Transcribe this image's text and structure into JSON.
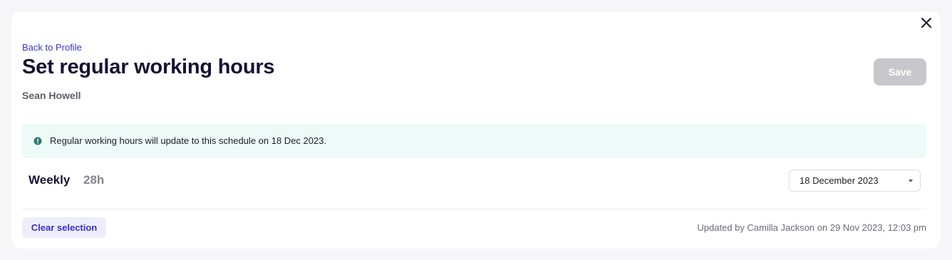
{
  "header": {
    "back_link": "Back to Profile",
    "title": "Set regular working hours",
    "person_name": "Sean Howell",
    "save_label": "Save",
    "close_icon": "close-icon"
  },
  "banner": {
    "icon": "info-icon",
    "text": "Regular working hours will update to this schedule on 18 Dec 2023."
  },
  "schedule": {
    "period_label": "Weekly",
    "total_hours": "28h",
    "effective_date": "18 December 2023"
  },
  "footer": {
    "clear_label": "Clear selection",
    "updated_text": "Updated by Camilla Jackson on 29 Nov 2023, 12:03 pm"
  },
  "colors": {
    "accent": "#3b2fc9",
    "title": "#161233",
    "banner_bg": "#eefaf7",
    "info_icon": "#2e7d6f",
    "save_disabled": "#c8c8cc"
  }
}
